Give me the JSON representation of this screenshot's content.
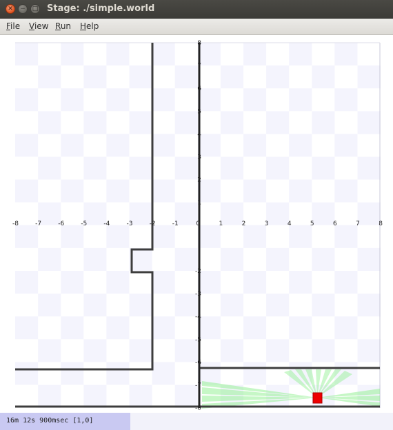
{
  "window": {
    "title": "Stage: ./simple.world",
    "close_glyph": "✕",
    "minimize_glyph": "−",
    "maximize_glyph": "□"
  },
  "menu": {
    "items": [
      {
        "label": "File",
        "mnemonic": "F",
        "rest": "ile"
      },
      {
        "label": "View",
        "mnemonic": "V",
        "rest": "iew"
      },
      {
        "label": "Run",
        "mnemonic": "R",
        "rest": "un"
      },
      {
        "label": "Help",
        "mnemonic": "H",
        "rest": "elp"
      }
    ]
  },
  "world": {
    "x_ticks": [
      "-8",
      "-7",
      "-6",
      "-5",
      "-4",
      "-3",
      "-2",
      "-1",
      "0",
      "1",
      "2",
      "3",
      "4",
      "5",
      "6",
      "7",
      "8"
    ],
    "y_ticks": [
      "8",
      "7",
      "6",
      "5",
      "4",
      "3",
      "2",
      "1",
      "-2",
      "-3",
      "-4",
      "-5",
      "-6",
      "-7",
      "-8"
    ],
    "colors": {
      "checker_light": "#f4f4fd",
      "checker_white": "#ffffff",
      "wall": "#3d3d3d",
      "robot": "#ee0000",
      "sensor_green": "#8ef08e",
      "axis": "#222222"
    },
    "robot_icon": "robot-square-icon"
  },
  "status": {
    "text": "16m 12s 900msec [1,0]"
  }
}
